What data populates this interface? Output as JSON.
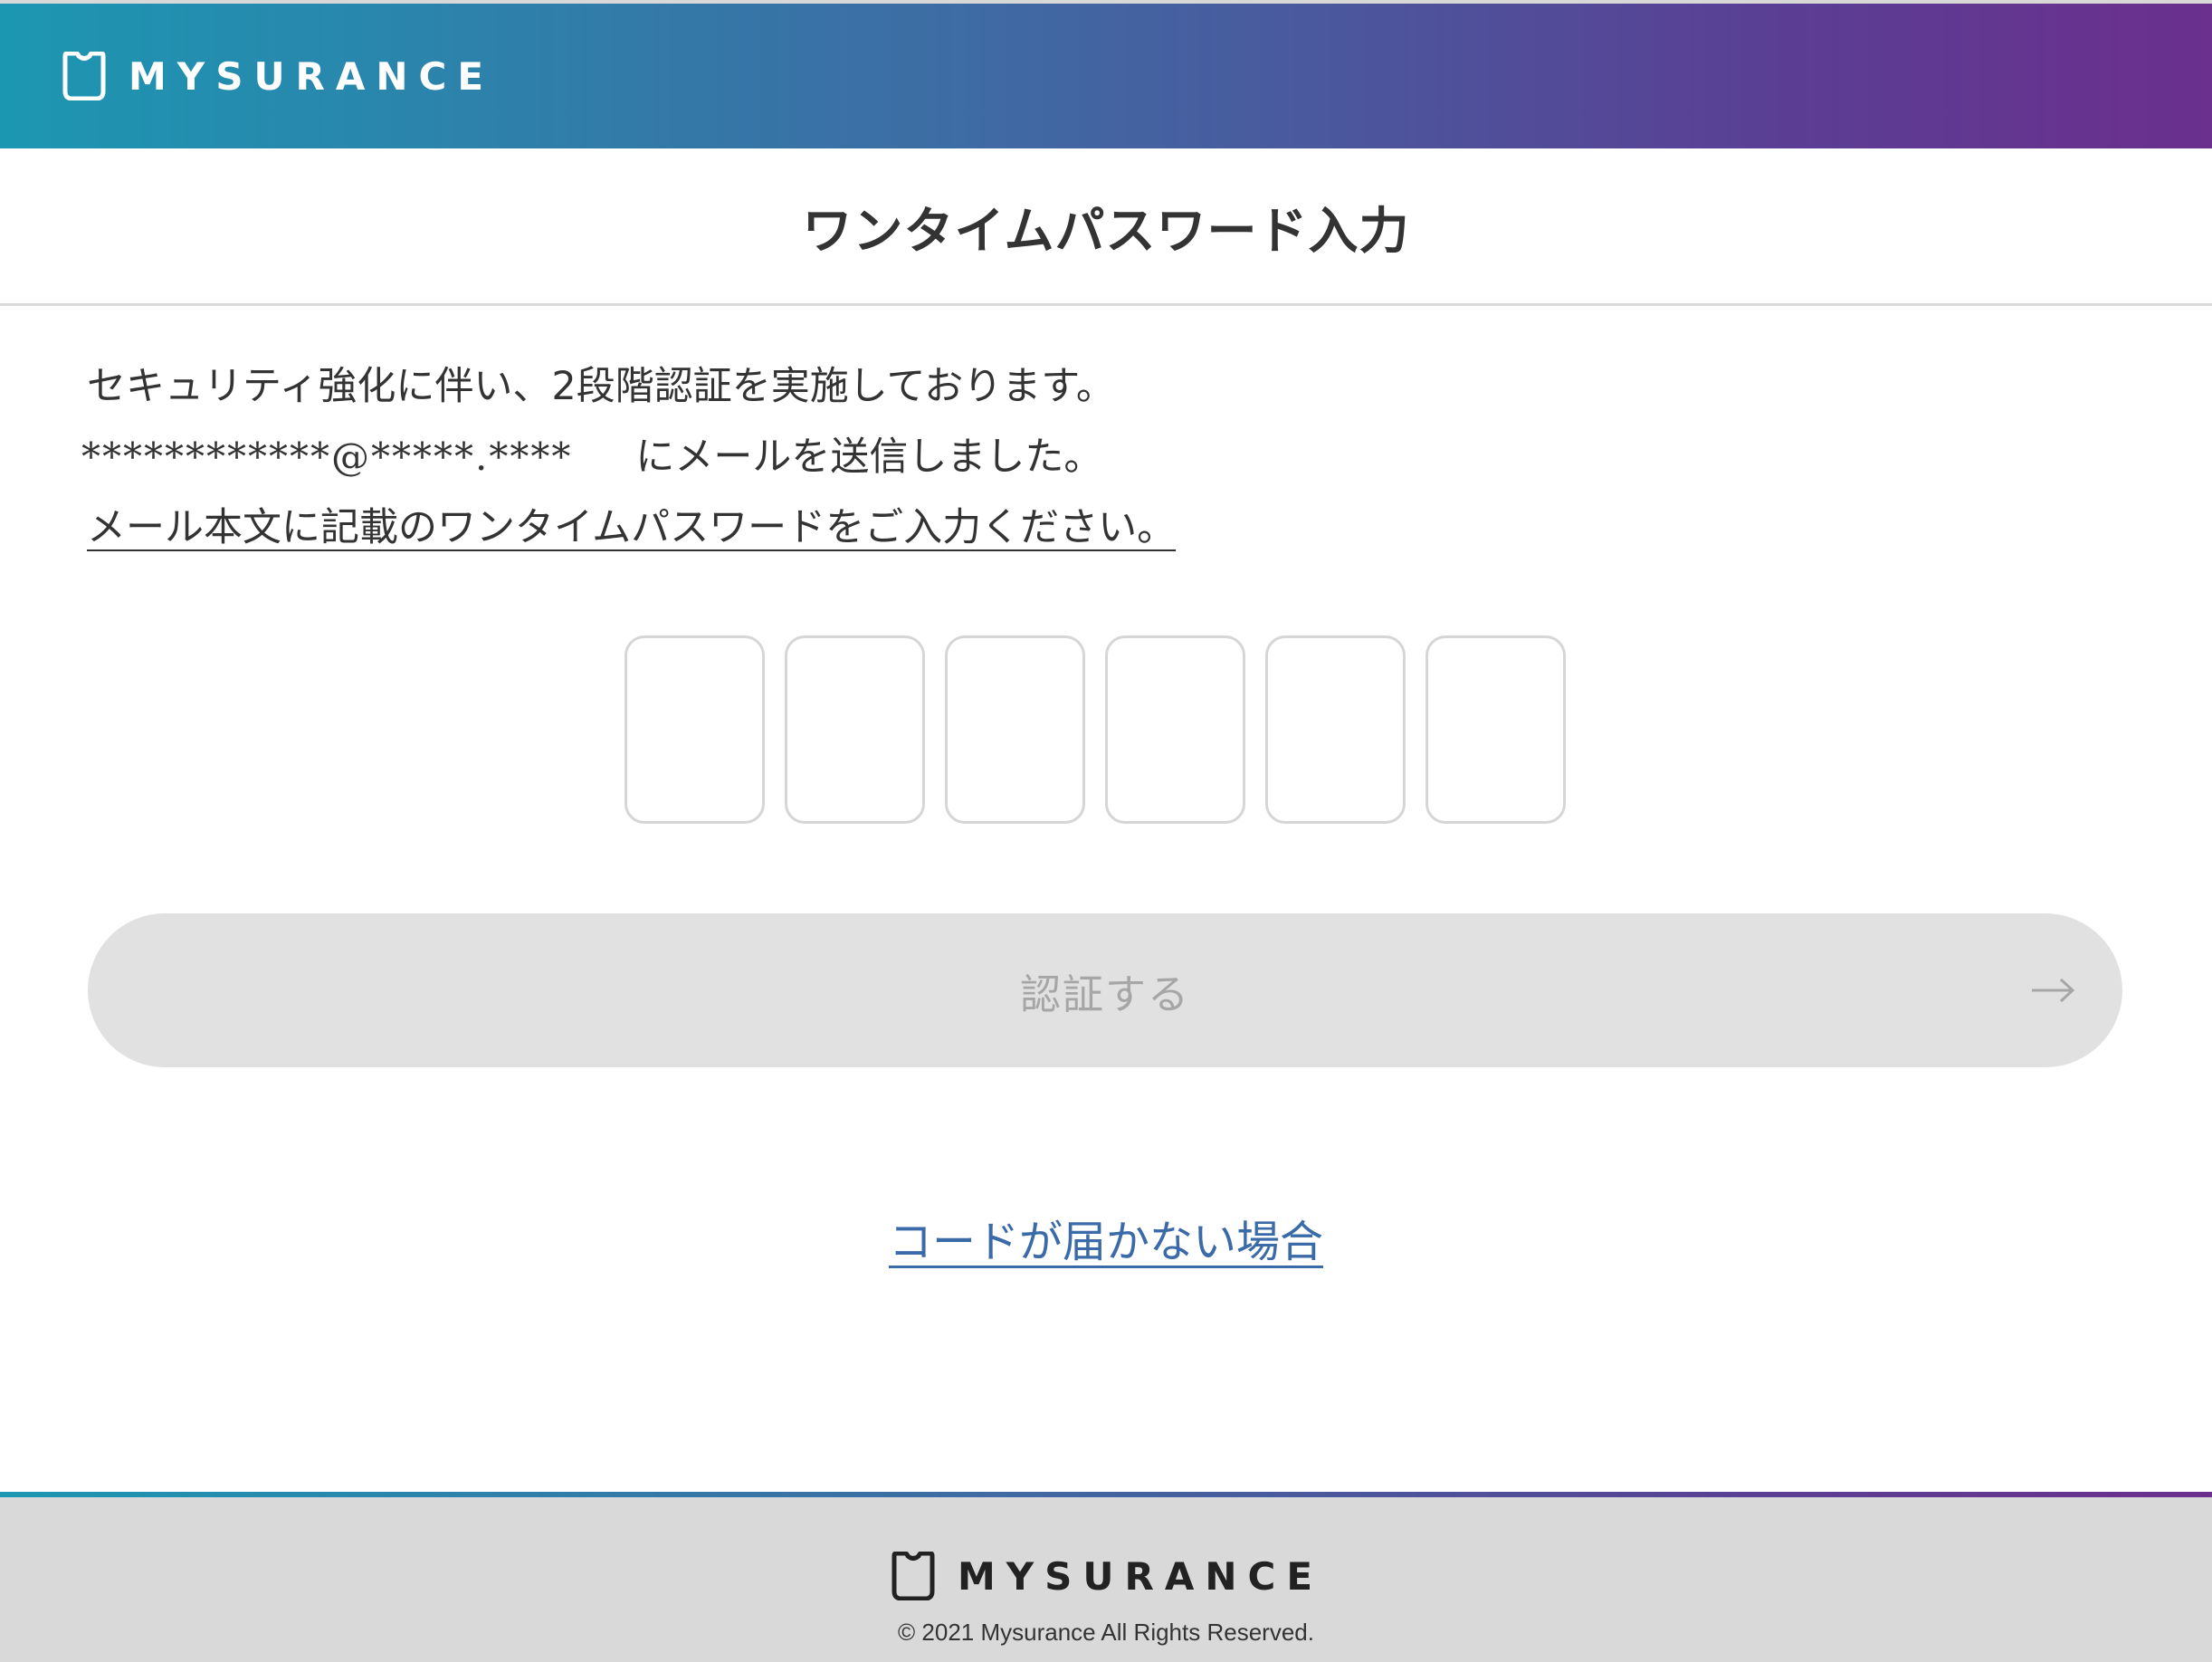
{
  "header": {
    "logo_text": "MYSURANCE",
    "logo_icon": "shield-icon"
  },
  "title": "ワンタイムパスワード入力",
  "messages": {
    "line1": "セキュリティ強化に伴い、2段階認証を実施しております。",
    "email": "************@*****.****",
    "line2_suffix": "にメールを送信しました。",
    "line3": "メール本文に記載のワンタイムパスワードをご入力ください。"
  },
  "otp": {
    "digits": [
      "",
      "",
      "",
      "",
      "",
      ""
    ]
  },
  "verify_button": {
    "label": "認証する",
    "icon": "arrow-right-icon",
    "state": "disabled"
  },
  "help_link": {
    "label": "コードが届かない場合"
  },
  "footer": {
    "logo_text": "MYSURANCE",
    "copyright": "© 2021 Mysurance All Rights Reserved."
  },
  "colors": {
    "gradient_start": "#1c97b2",
    "gradient_end": "#6b2f8d",
    "link": "#3a6aa8",
    "button_bg": "#e1e1e1",
    "button_text": "#a6a6a6",
    "footer_bg": "#d9d9d9"
  }
}
